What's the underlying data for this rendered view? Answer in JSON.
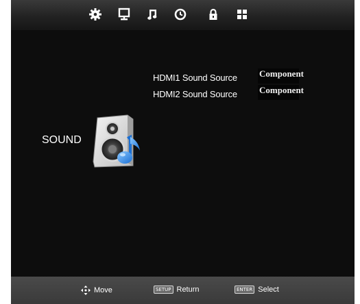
{
  "menu_tabs": [
    {
      "id": "setup",
      "icon": "gear-icon"
    },
    {
      "id": "picture",
      "icon": "monitor-icon"
    },
    {
      "id": "sound",
      "icon": "music-note-icon"
    },
    {
      "id": "time",
      "icon": "clock-icon"
    },
    {
      "id": "lock",
      "icon": "lock-icon"
    },
    {
      "id": "apps",
      "icon": "grid-icon"
    }
  ],
  "section": {
    "label": "SOUND",
    "icon": "speaker-icon"
  },
  "options": [
    {
      "label": "HDMI1 Sound Source",
      "value": "Component"
    },
    {
      "label": "HDMI2 Sound Source",
      "value": "Component"
    }
  ],
  "footer": {
    "move_label": "Move",
    "return_key": "SETUP",
    "return_label": "Return",
    "select_key": "ENTER",
    "select_label": "Select"
  },
  "colors": {
    "background": "#0d0d0d",
    "bar": "#3a3a3a",
    "text": "#ffffff"
  }
}
